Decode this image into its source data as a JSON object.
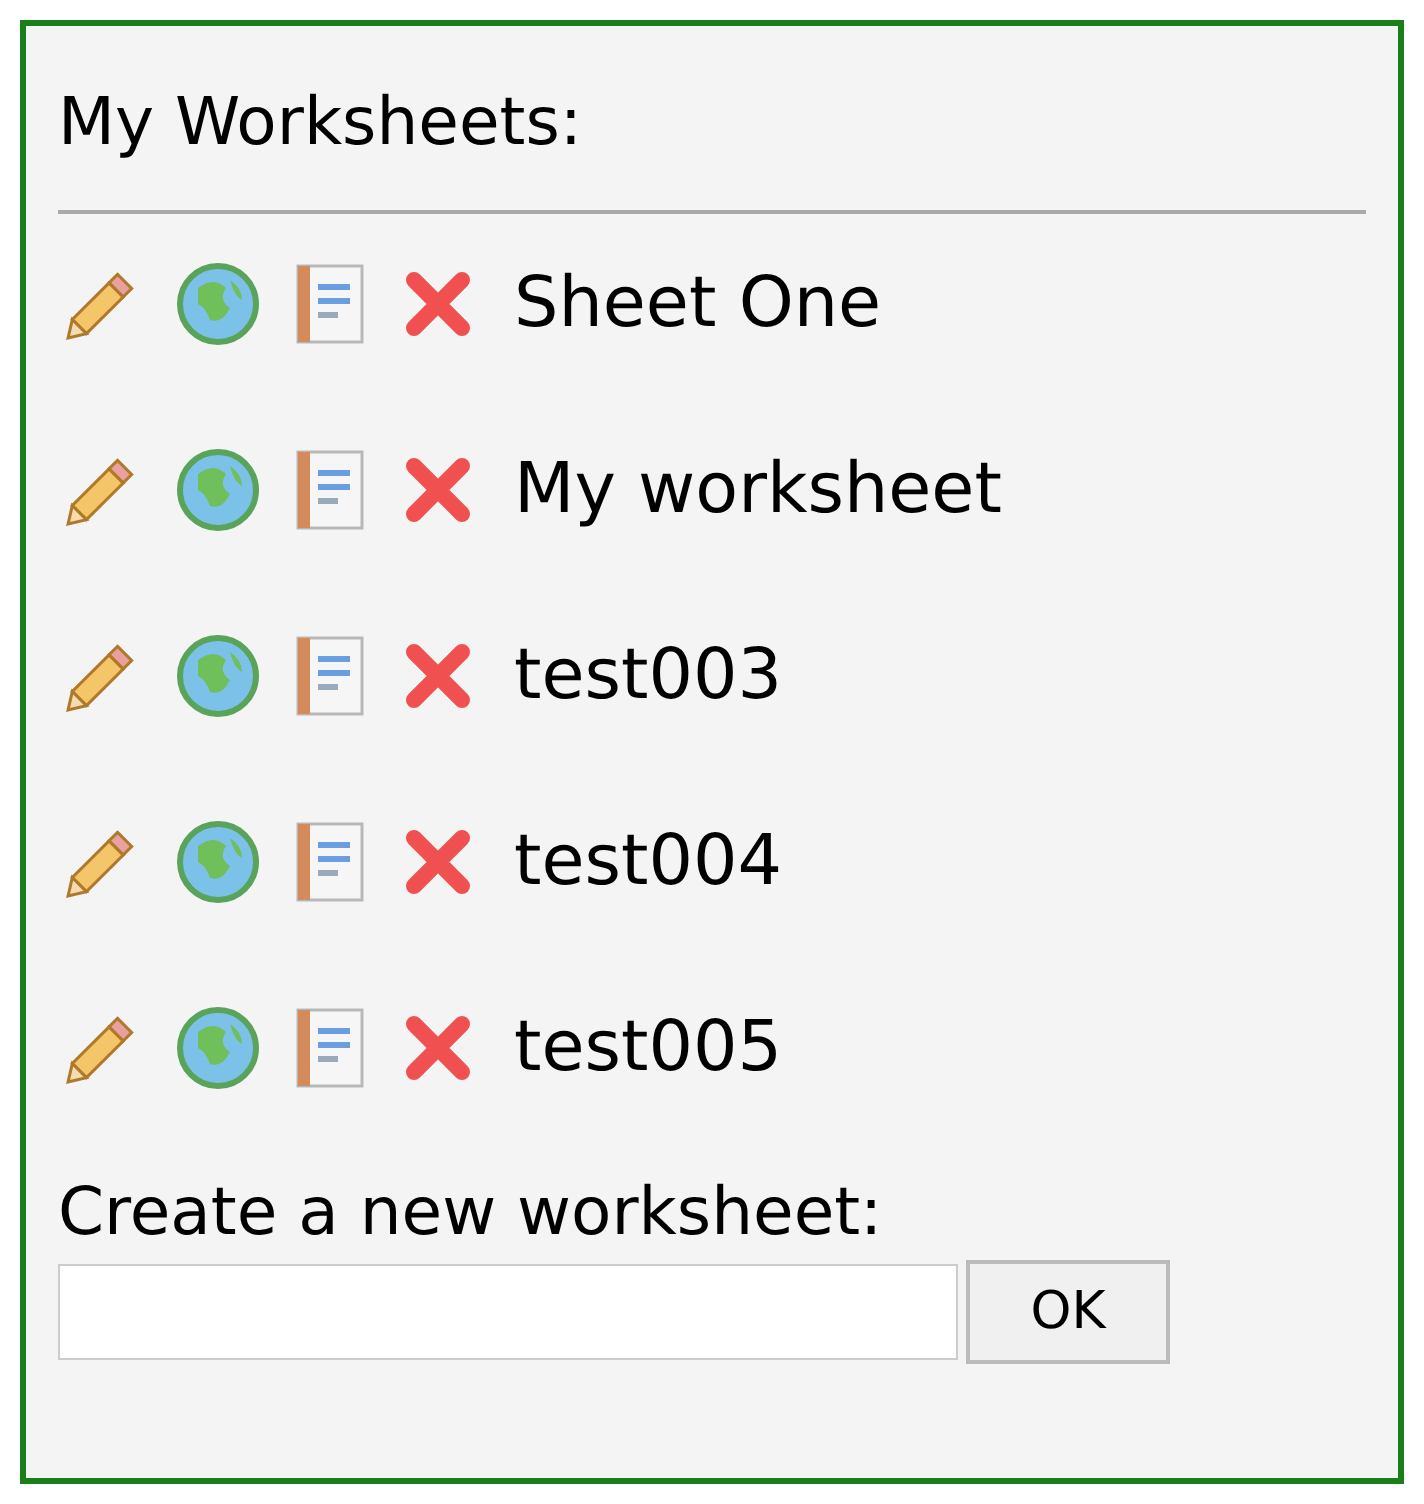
{
  "title": "My Worksheets:",
  "worksheets": [
    {
      "name": "Sheet One"
    },
    {
      "name": "My worksheet"
    },
    {
      "name": "test003"
    },
    {
      "name": "test004"
    },
    {
      "name": "test005"
    }
  ],
  "create": {
    "label": "Create a new worksheet:",
    "button": "OK"
  }
}
